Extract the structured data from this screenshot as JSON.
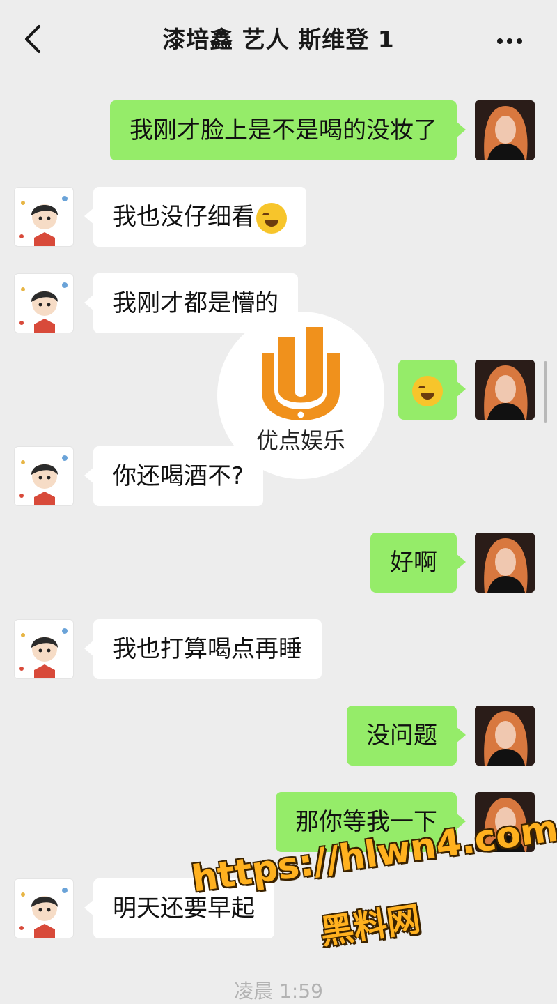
{
  "header": {
    "title": "漆培鑫 艺人 斯维登 1",
    "back_icon": "chevron-left-icon",
    "more_icon": "more-dots-icon"
  },
  "messages": [
    {
      "side": "self",
      "text": "我刚才脸上是不是喝的没妆了"
    },
    {
      "side": "other",
      "text": "我也没仔细看",
      "emoji": "laugh-cry-emoji"
    },
    {
      "side": "other",
      "text": "我刚才都是懵的"
    },
    {
      "side": "self",
      "text": "",
      "emoji": "laugh-cry-emoji"
    },
    {
      "side": "other",
      "text": "你还喝酒不?"
    },
    {
      "side": "self",
      "text": "好啊"
    },
    {
      "side": "other",
      "text": "我也打算喝点再睡"
    },
    {
      "side": "self",
      "text": "没问题"
    },
    {
      "side": "self",
      "text": "那你等我一下"
    },
    {
      "side": "other",
      "text": "明天还要早起"
    }
  ],
  "overlay_logo": {
    "text": "优点娱乐",
    "color": "#f0911c"
  },
  "watermark": {
    "url": "https://hlwn4.com",
    "name": "黑料网"
  },
  "timestamp": "凌晨 1:59",
  "colors": {
    "self_bubble": "#95ec69",
    "other_bubble": "#ffffff",
    "background": "#ededed"
  }
}
